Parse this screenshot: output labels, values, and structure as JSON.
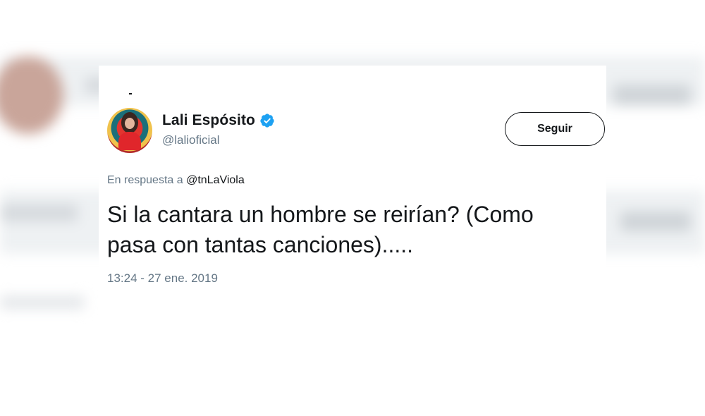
{
  "tweet": {
    "author_name": "Lali Espósito",
    "author_handle": "@lalioficial",
    "verified": true,
    "follow_label": "Seguir",
    "reply_prefix": "En respuesta a",
    "reply_mention": "@tnLaViola",
    "text_line1": "Si la cantara un hombre se reirían? (Como",
    "text_line2": "pasa con tantas canciones).....",
    "timestamp": "13:24 - 27 ene. 2019"
  },
  "colors": {
    "verified_blue": "#1da1f2",
    "text_primary": "#14171a",
    "text_secondary": "#657786"
  },
  "icons": {
    "verified": "verified-badge-icon",
    "avatar": "profile-avatar"
  }
}
